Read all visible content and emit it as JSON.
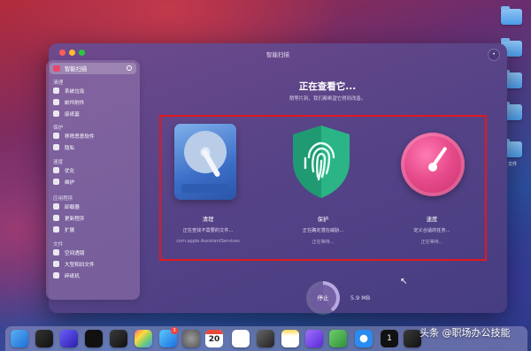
{
  "window": {
    "title": "智能扫描"
  },
  "assistant_label": "•",
  "sidebar": {
    "top": {
      "label": "智能扫描"
    },
    "sections": [
      {
        "header": "清理",
        "items": [
          {
            "label": "系统垃圾"
          },
          {
            "label": "邮件附件"
          },
          {
            "label": "废纸篓"
          }
        ]
      },
      {
        "header": "保护",
        "items": [
          {
            "label": "移除恶意软件"
          },
          {
            "label": "隐私"
          }
        ]
      },
      {
        "header": "速度",
        "items": [
          {
            "label": "优化"
          },
          {
            "label": "维护"
          }
        ]
      },
      {
        "header": "应用程序",
        "items": [
          {
            "label": "卸载器"
          },
          {
            "label": "更新程序"
          },
          {
            "label": "扩展"
          }
        ]
      },
      {
        "header": "文件",
        "items": [
          {
            "label": "空间透镜"
          },
          {
            "label": "大型和旧文件"
          },
          {
            "label": "碎纸机"
          }
        ]
      }
    ]
  },
  "main": {
    "heading": "正在查看它...",
    "subheading": "稍等片刻，我们都希望它得到改善。",
    "cards": [
      {
        "title": "清理",
        "status": "正在查找不需要的文件...",
        "detail": "com.apple.AssistantServices"
      },
      {
        "title": "保护",
        "status": "正在确定潜在威胁...",
        "detail": "正在等待..."
      },
      {
        "title": "速度",
        "status": "定义合适的任务...",
        "detail": "正在等待..."
      }
    ],
    "stop_button": "停止",
    "size": "5.9 MB",
    "progress": 0.4
  },
  "desktop": {
    "label": "文件"
  },
  "dock": {
    "calendar_day": "20",
    "app_store_badge": "3",
    "one_label": "1"
  },
  "watermark": "头条 @职场办公技能",
  "colors": {
    "highlight_border": "#e0191f",
    "card_protect_shield": "#22a07a",
    "card_speed_gauge": "#e64a8a",
    "card_clean_disk": "#3c6ec8"
  }
}
